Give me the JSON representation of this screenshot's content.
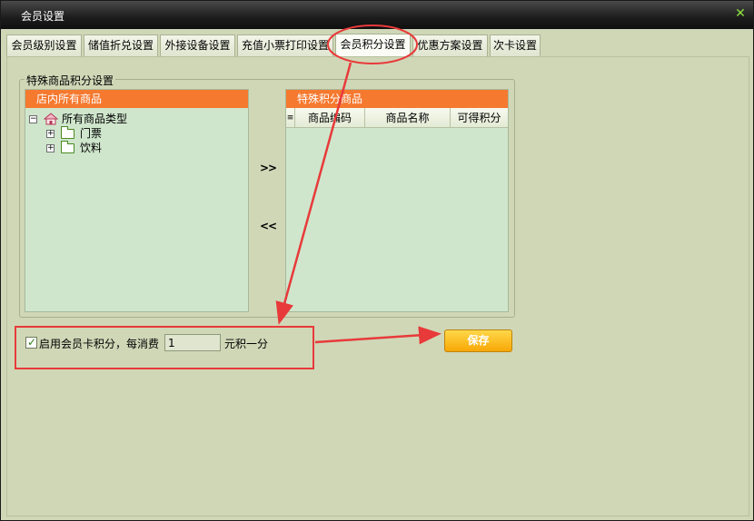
{
  "window": {
    "title": "会员设置",
    "close_glyph": "✕"
  },
  "tabs": [
    {
      "label": "会员级别设置",
      "active": false
    },
    {
      "label": "储值折兑设置",
      "active": false
    },
    {
      "label": "外接设备设置",
      "active": false
    },
    {
      "label": "充值小票打印设置",
      "active": false
    },
    {
      "label": "会员积分设置",
      "active": true
    },
    {
      "label": "优惠方案设置",
      "active": false
    },
    {
      "label": "次卡设置",
      "active": false
    }
  ],
  "special_points": {
    "group_title": "特殊商品积分设置",
    "store_goods": {
      "header": "店内所有商品",
      "root": "所有商品类型",
      "children": [
        "门票",
        "饮料"
      ]
    },
    "special_goods": {
      "header": "特殊积分商品",
      "columns": [
        "商品编码",
        "商品名称",
        "可得积分"
      ]
    },
    "add_button": ">>",
    "remove_button": "<<"
  },
  "member_points": {
    "enabled": true,
    "label": "启用会员卡积分，每消费",
    "amount": "1",
    "suffix": "元积一分"
  },
  "save_button": "保存",
  "colors": {
    "accent_orange": "#f5792f",
    "save_button": "#f8a706",
    "annotation_red": "#e83a3a",
    "tab_close": "#8ee23c"
  },
  "icons": {
    "close": "close-icon",
    "home": "home-icon",
    "folder": "folder-icon",
    "expand": "plus-expander-icon",
    "collapse": "minus-collapser-icon"
  }
}
